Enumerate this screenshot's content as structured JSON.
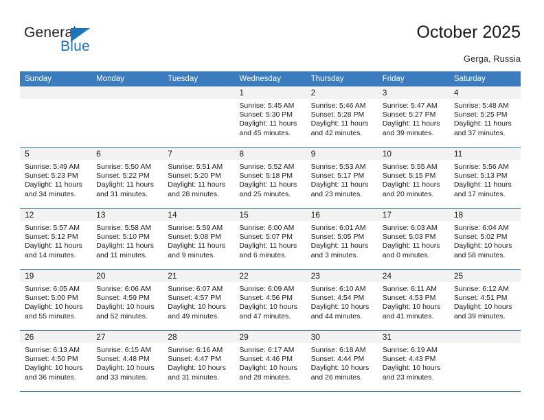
{
  "brand": {
    "word1": "General",
    "word2": "Blue",
    "accent_color": "#1b75bb"
  },
  "header": {
    "title": "October 2025",
    "subtitle": "Gerga, Russia",
    "header_bg": "#3a7cbe",
    "band_bg": "#f2f2f2"
  },
  "weekdays": [
    "Sunday",
    "Monday",
    "Tuesday",
    "Wednesday",
    "Thursday",
    "Friday",
    "Saturday"
  ],
  "labels": {
    "sunrise": "Sunrise:",
    "sunset": "Sunset:",
    "daylight": "Daylight:"
  },
  "weeks": [
    [
      {
        "day": "",
        "empty": true
      },
      {
        "day": "",
        "empty": true
      },
      {
        "day": "",
        "empty": true
      },
      {
        "day": "1",
        "sunrise": "Sunrise: 5:45 AM",
        "sunset": "Sunset: 5:30 PM",
        "daylight": "Daylight: 11 hours and 45 minutes."
      },
      {
        "day": "2",
        "sunrise": "Sunrise: 5:46 AM",
        "sunset": "Sunset: 5:28 PM",
        "daylight": "Daylight: 11 hours and 42 minutes."
      },
      {
        "day": "3",
        "sunrise": "Sunrise: 5:47 AM",
        "sunset": "Sunset: 5:27 PM",
        "daylight": "Daylight: 11 hours and 39 minutes."
      },
      {
        "day": "4",
        "sunrise": "Sunrise: 5:48 AM",
        "sunset": "Sunset: 5:25 PM",
        "daylight": "Daylight: 11 hours and 37 minutes."
      }
    ],
    [
      {
        "day": "5",
        "sunrise": "Sunrise: 5:49 AM",
        "sunset": "Sunset: 5:23 PM",
        "daylight": "Daylight: 11 hours and 34 minutes."
      },
      {
        "day": "6",
        "sunrise": "Sunrise: 5:50 AM",
        "sunset": "Sunset: 5:22 PM",
        "daylight": "Daylight: 11 hours and 31 minutes."
      },
      {
        "day": "7",
        "sunrise": "Sunrise: 5:51 AM",
        "sunset": "Sunset: 5:20 PM",
        "daylight": "Daylight: 11 hours and 28 minutes."
      },
      {
        "day": "8",
        "sunrise": "Sunrise: 5:52 AM",
        "sunset": "Sunset: 5:18 PM",
        "daylight": "Daylight: 11 hours and 25 minutes."
      },
      {
        "day": "9",
        "sunrise": "Sunrise: 5:53 AM",
        "sunset": "Sunset: 5:17 PM",
        "daylight": "Daylight: 11 hours and 23 minutes."
      },
      {
        "day": "10",
        "sunrise": "Sunrise: 5:55 AM",
        "sunset": "Sunset: 5:15 PM",
        "daylight": "Daylight: 11 hours and 20 minutes."
      },
      {
        "day": "11",
        "sunrise": "Sunrise: 5:56 AM",
        "sunset": "Sunset: 5:13 PM",
        "daylight": "Daylight: 11 hours and 17 minutes."
      }
    ],
    [
      {
        "day": "12",
        "sunrise": "Sunrise: 5:57 AM",
        "sunset": "Sunset: 5:12 PM",
        "daylight": "Daylight: 11 hours and 14 minutes."
      },
      {
        "day": "13",
        "sunrise": "Sunrise: 5:58 AM",
        "sunset": "Sunset: 5:10 PM",
        "daylight": "Daylight: 11 hours and 11 minutes."
      },
      {
        "day": "14",
        "sunrise": "Sunrise: 5:59 AM",
        "sunset": "Sunset: 5:08 PM",
        "daylight": "Daylight: 11 hours and 9 minutes."
      },
      {
        "day": "15",
        "sunrise": "Sunrise: 6:00 AM",
        "sunset": "Sunset: 5:07 PM",
        "daylight": "Daylight: 11 hours and 6 minutes."
      },
      {
        "day": "16",
        "sunrise": "Sunrise: 6:01 AM",
        "sunset": "Sunset: 5:05 PM",
        "daylight": "Daylight: 11 hours and 3 minutes."
      },
      {
        "day": "17",
        "sunrise": "Sunrise: 6:03 AM",
        "sunset": "Sunset: 5:03 PM",
        "daylight": "Daylight: 11 hours and 0 minutes."
      },
      {
        "day": "18",
        "sunrise": "Sunrise: 6:04 AM",
        "sunset": "Sunset: 5:02 PM",
        "daylight": "Daylight: 10 hours and 58 minutes."
      }
    ],
    [
      {
        "day": "19",
        "sunrise": "Sunrise: 6:05 AM",
        "sunset": "Sunset: 5:00 PM",
        "daylight": "Daylight: 10 hours and 55 minutes."
      },
      {
        "day": "20",
        "sunrise": "Sunrise: 6:06 AM",
        "sunset": "Sunset: 4:59 PM",
        "daylight": "Daylight: 10 hours and 52 minutes."
      },
      {
        "day": "21",
        "sunrise": "Sunrise: 6:07 AM",
        "sunset": "Sunset: 4:57 PM",
        "daylight": "Daylight: 10 hours and 49 minutes."
      },
      {
        "day": "22",
        "sunrise": "Sunrise: 6:09 AM",
        "sunset": "Sunset: 4:56 PM",
        "daylight": "Daylight: 10 hours and 47 minutes."
      },
      {
        "day": "23",
        "sunrise": "Sunrise: 6:10 AM",
        "sunset": "Sunset: 4:54 PM",
        "daylight": "Daylight: 10 hours and 44 minutes."
      },
      {
        "day": "24",
        "sunrise": "Sunrise: 6:11 AM",
        "sunset": "Sunset: 4:53 PM",
        "daylight": "Daylight: 10 hours and 41 minutes."
      },
      {
        "day": "25",
        "sunrise": "Sunrise: 6:12 AM",
        "sunset": "Sunset: 4:51 PM",
        "daylight": "Daylight: 10 hours and 39 minutes."
      }
    ],
    [
      {
        "day": "26",
        "sunrise": "Sunrise: 6:13 AM",
        "sunset": "Sunset: 4:50 PM",
        "daylight": "Daylight: 10 hours and 36 minutes."
      },
      {
        "day": "27",
        "sunrise": "Sunrise: 6:15 AM",
        "sunset": "Sunset: 4:48 PM",
        "daylight": "Daylight: 10 hours and 33 minutes."
      },
      {
        "day": "28",
        "sunrise": "Sunrise: 6:16 AM",
        "sunset": "Sunset: 4:47 PM",
        "daylight": "Daylight: 10 hours and 31 minutes."
      },
      {
        "day": "29",
        "sunrise": "Sunrise: 6:17 AM",
        "sunset": "Sunset: 4:46 PM",
        "daylight": "Daylight: 10 hours and 28 minutes."
      },
      {
        "day": "30",
        "sunrise": "Sunrise: 6:18 AM",
        "sunset": "Sunset: 4:44 PM",
        "daylight": "Daylight: 10 hours and 26 minutes."
      },
      {
        "day": "31",
        "sunrise": "Sunrise: 6:19 AM",
        "sunset": "Sunset: 4:43 PM",
        "daylight": "Daylight: 10 hours and 23 minutes."
      },
      {
        "day": "",
        "empty": true
      }
    ]
  ]
}
